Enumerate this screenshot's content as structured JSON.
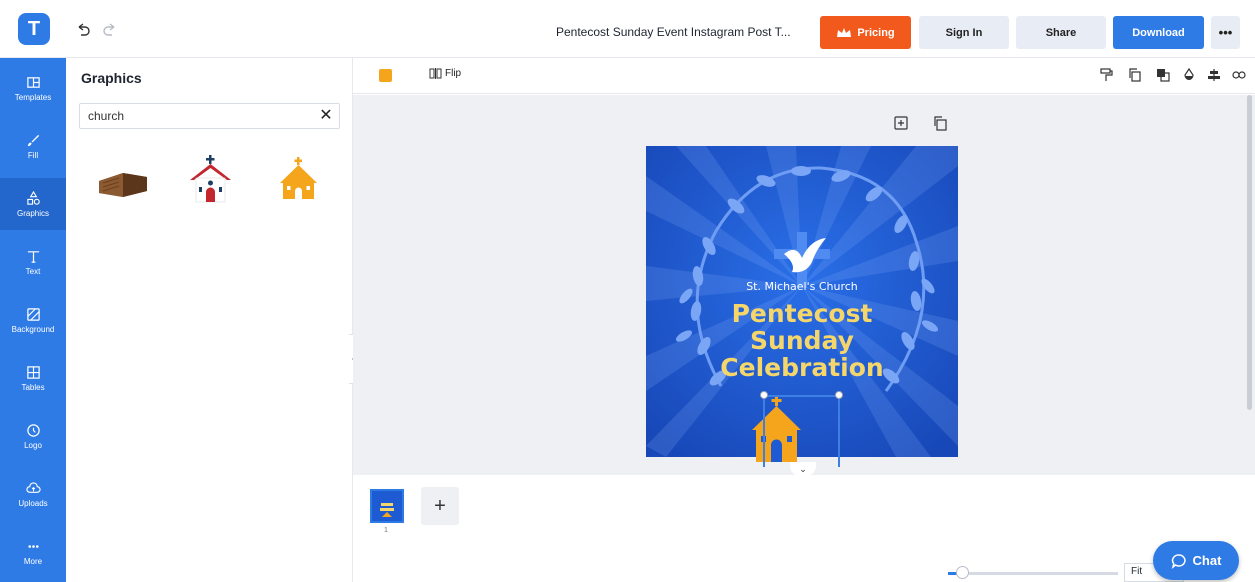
{
  "topbar": {
    "logo_letter": "T",
    "doc_title": "Pentecost Sunday Event Instagram Post T...",
    "pricing_label": "Pricing",
    "signin_label": "Sign In",
    "share_label": "Share",
    "download_label": "Download",
    "more_label": "•••"
  },
  "sidebar": {
    "items": [
      {
        "label": "Templates",
        "icon": "templates-icon"
      },
      {
        "label": "Fill",
        "icon": "brush-icon"
      },
      {
        "label": "Graphics",
        "icon": "shapes-icon"
      },
      {
        "label": "Text",
        "icon": "text-icon"
      },
      {
        "label": "Background",
        "icon": "background-icon"
      },
      {
        "label": "Tables",
        "icon": "table-icon"
      },
      {
        "label": "Logo",
        "icon": "logo-icon"
      },
      {
        "label": "Uploads",
        "icon": "upload-icon"
      },
      {
        "label": "More",
        "icon": "dots-icon"
      }
    ],
    "active": "Graphics"
  },
  "panel": {
    "title": "Graphics",
    "search_value": "church",
    "clear_label": "✕",
    "results": [
      "wooden-church-icon",
      "church-icon",
      "orange-church-icon"
    ]
  },
  "toolbar": {
    "color": "#f5a51b",
    "flip_label": "Flip",
    "icons": [
      "paint-roller-icon",
      "copy-icon",
      "layer-icon",
      "opacity-icon",
      "align-icon",
      "link-icon",
      "trash-icon"
    ]
  },
  "canvas": {
    "church_name": "St. Michael's Church",
    "headline_1": "Pentecost",
    "headline_2": "Sunday",
    "headline_3": "Celebration"
  },
  "pages": {
    "current": "1",
    "add_label": "+"
  },
  "bottom": {
    "collapse_label": "<",
    "fit_label": "Fit",
    "chat_label": "Chat"
  },
  "colors": {
    "brand": "#2f7be6",
    "pricing": "#f25a1d",
    "artboard": "#1e5bd3",
    "headline": "#f5d66b",
    "church": "#f5a51b"
  }
}
